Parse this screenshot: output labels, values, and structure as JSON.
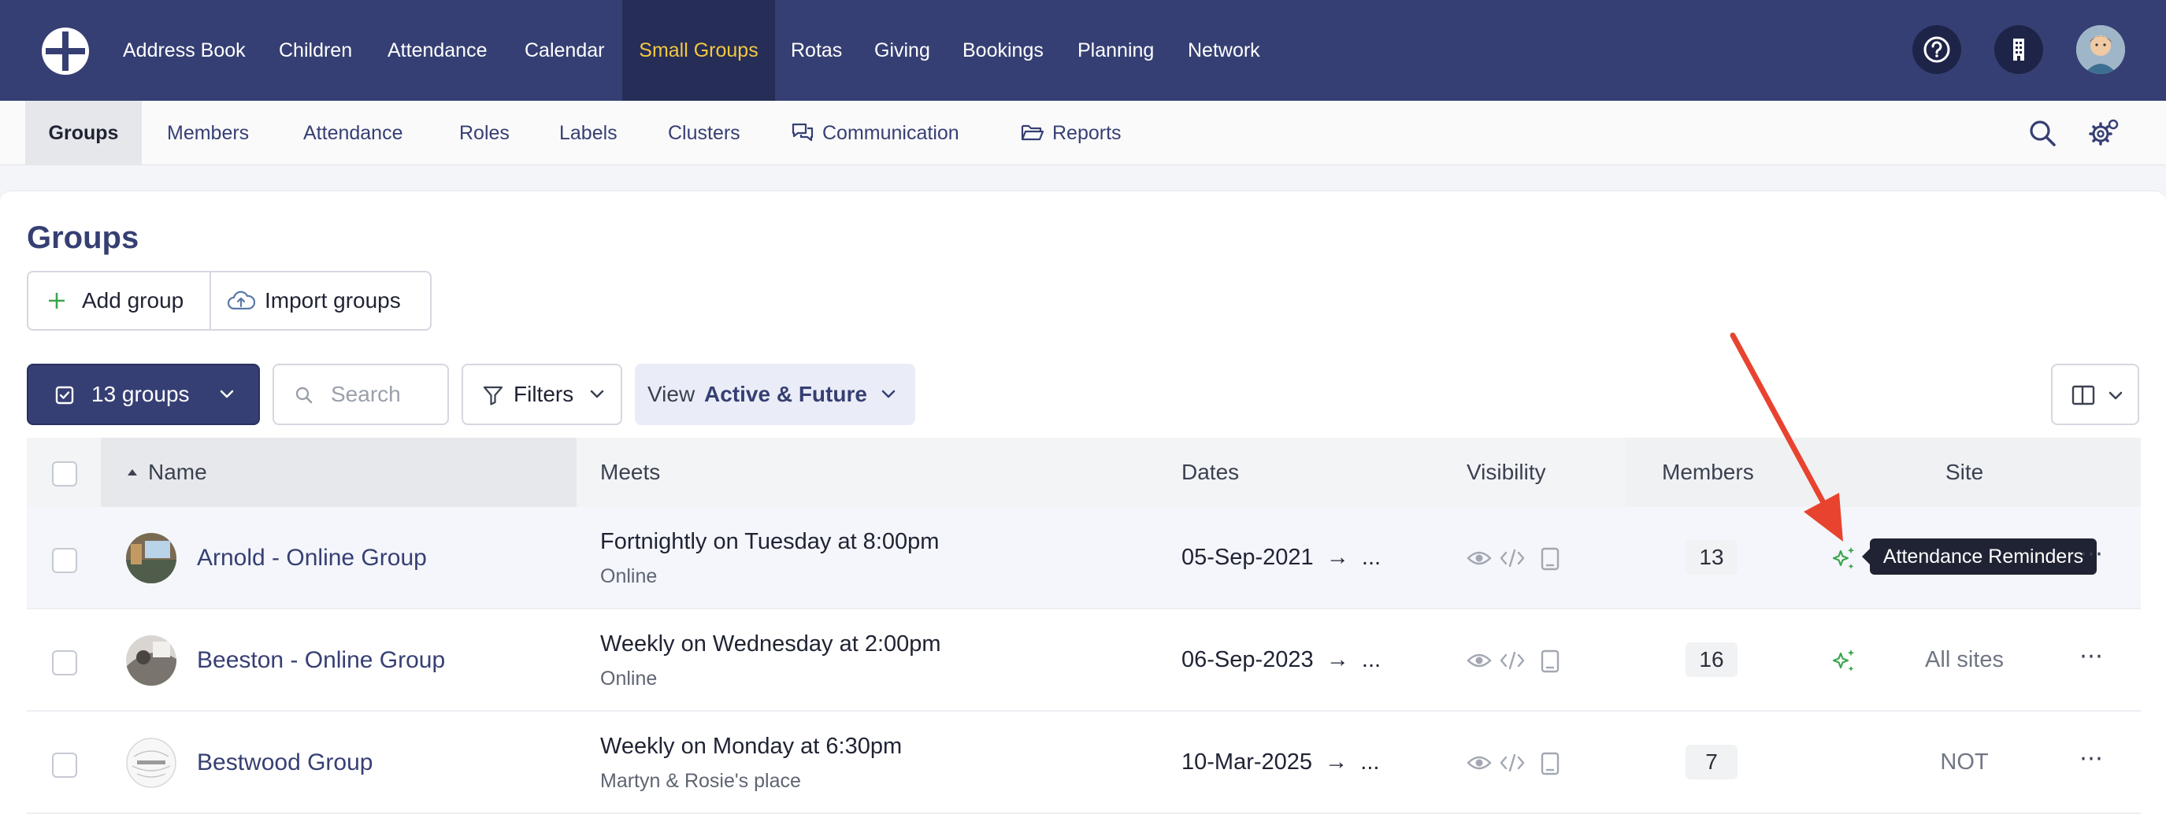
{
  "topnav": {
    "items": [
      "Address Book",
      "Children",
      "Attendance",
      "Calendar",
      "Small Groups",
      "Rotas",
      "Giving",
      "Bookings",
      "Planning",
      "Network"
    ],
    "active": "Small Groups"
  },
  "subnav": {
    "items": [
      "Groups",
      "Members",
      "Attendance",
      "Roles",
      "Labels",
      "Clusters",
      "Communication",
      "Reports"
    ],
    "active": "Groups"
  },
  "page": {
    "title": "Groups",
    "add_group": "Add group",
    "import_groups": "Import groups"
  },
  "toolbar": {
    "selection": "13 groups",
    "search_placeholder": "Search",
    "filters": "Filters",
    "view_label": "View",
    "view_value": "Active & Future"
  },
  "table": {
    "headers": {
      "name": "Name",
      "meets": "Meets",
      "dates": "Dates",
      "visibility": "Visibility",
      "members": "Members",
      "site": "Site"
    },
    "rows": [
      {
        "name": "Arnold - Online Group",
        "meets": "Fortnightly on Tuesday at 8:00pm",
        "location": "Online",
        "start_date": "05-Sep-2021",
        "end": "...",
        "members": "13",
        "site": ""
      },
      {
        "name": "Beeston - Online Group",
        "meets": "Weekly on Wednesday at 2:00pm",
        "location": "Online",
        "start_date": "06-Sep-2023",
        "end": "...",
        "members": "16",
        "site": "All sites"
      },
      {
        "name": "Bestwood Group",
        "meets": "Weekly on Monday at 6:30pm",
        "location": "Martyn & Rosie's place",
        "start_date": "10-Mar-2025",
        "end": "...",
        "members": "7",
        "site": "NOT"
      }
    ]
  },
  "tooltip": {
    "text": "Attendance Reminders"
  },
  "colors": {
    "nav_bg": "#363f73",
    "nav_active_text": "#f4c842",
    "sparkle": "#3aa64c",
    "annotation_arrow": "#e8432f"
  }
}
